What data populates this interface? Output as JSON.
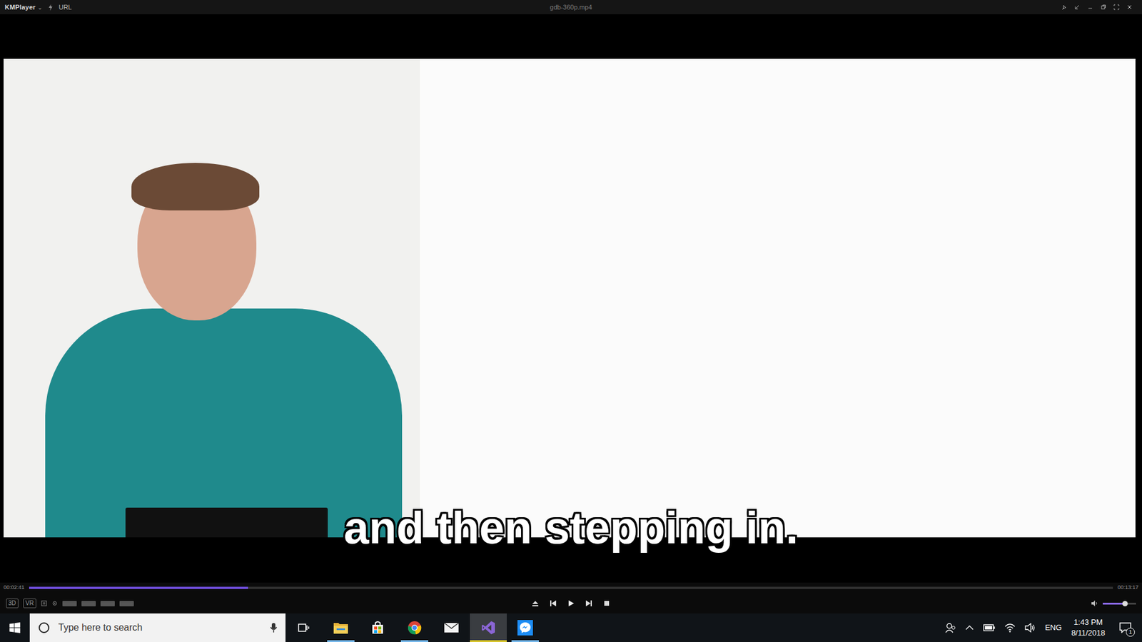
{
  "window": {
    "app": "KMPlayer",
    "menu_arrow": "⌄",
    "url_label": "URL",
    "title": "gdb-360p.mp4"
  },
  "subtitle": "and then stepping in.",
  "playback": {
    "elapsed": "00:02:41",
    "total": "00:13:17",
    "level": 0.202
  },
  "left_buttons": [
    "3D",
    "VR"
  ],
  "volume": {
    "level": 0.68
  },
  "taskbar": {
    "search_placeholder": "Type here to search",
    "apps": [
      {
        "kind": "explorer",
        "running": true,
        "selected": false
      },
      {
        "kind": "store",
        "running": false,
        "selected": false
      },
      {
        "kind": "chrome",
        "running": true,
        "selected": false
      },
      {
        "kind": "mail",
        "running": false,
        "selected": false
      },
      {
        "kind": "visualstudio",
        "running": true,
        "selected": true
      },
      {
        "kind": "messenger",
        "running": true,
        "selected": false
      }
    ]
  },
  "tray": {
    "language": "ENG",
    "time": "1:43 PM",
    "date": "8/11/2018",
    "notifications": "1"
  }
}
